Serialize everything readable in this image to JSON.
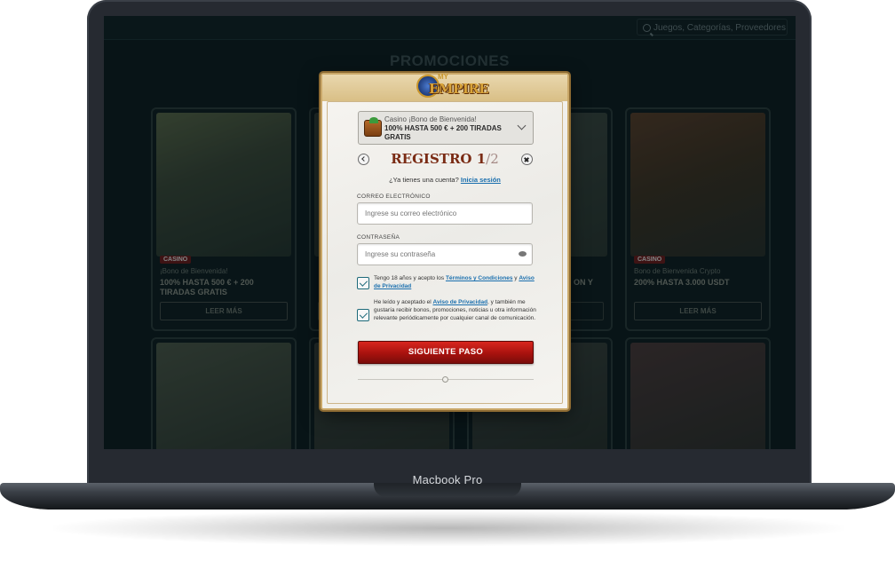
{
  "device": {
    "label": "Macbook Pro"
  },
  "site": {
    "search_placeholder": "Juegos, Categorías, Proveedores",
    "section_title": "PROMOCIONES",
    "cards": [
      {
        "tag": "CASINO",
        "subtitle": "¡Bono de Bienvenida!",
        "headline": "100% HASTA 500 € + 200 TIRADAS GRATIS",
        "button": "LEER MÁS",
        "accent": "#3d5a3a"
      },
      {
        "tag": "",
        "subtitle": "",
        "headline": "",
        "button": "",
        "accent": "#2c3a38"
      },
      {
        "tag": "",
        "subtitle": "",
        "headline": "ON Y",
        "button": "",
        "accent": "#2f3c3a"
      },
      {
        "tag": "CASINO",
        "subtitle": "Bono de Bienvenida Crypto",
        "headline": "200% HASTA 3.000 USDT",
        "button": "LEER MÁS",
        "accent": "#4a3a28"
      }
    ]
  },
  "modal": {
    "logo": {
      "my": "MY",
      "name": "EMPIRE"
    },
    "bonus": {
      "label": "Casino ¡Bono de Bienvenida!",
      "title": "100% HASTA 500 € + 200 TIRADAS GRATIS"
    },
    "step": {
      "title": "REGISTRO",
      "current": "1",
      "total": "/2"
    },
    "login_prompt": "¿Ya tienes una cuenta?",
    "login_link": "Inicia sesión",
    "email_label": "CORREO ELECTRÓNICO",
    "email_placeholder": "Ingrese su correo electrónico",
    "password_label": "CONTRASEÑA",
    "password_placeholder": "Ingrese su contraseña",
    "terms": {
      "prefix": "Tengo 18 años y acepto los ",
      "link1": "Términos y Condiciones",
      "mid": " y ",
      "link2": "Aviso de Privacidad"
    },
    "marketing": {
      "prefix": "He leído y aceptado el ",
      "link": "Aviso de Privacidad",
      "suffix": ", y también me gustaría recibir bonos, promociones, noticias u otra información relevante periódicamente por cualquier canal de comunicación."
    },
    "next_button": "SIGUIENTE PASO"
  },
  "colors": {
    "brand_red": "#a8120e",
    "link": "#1a6fae",
    "gold": "#c9a768",
    "checkbox": "#1d6a7a"
  }
}
